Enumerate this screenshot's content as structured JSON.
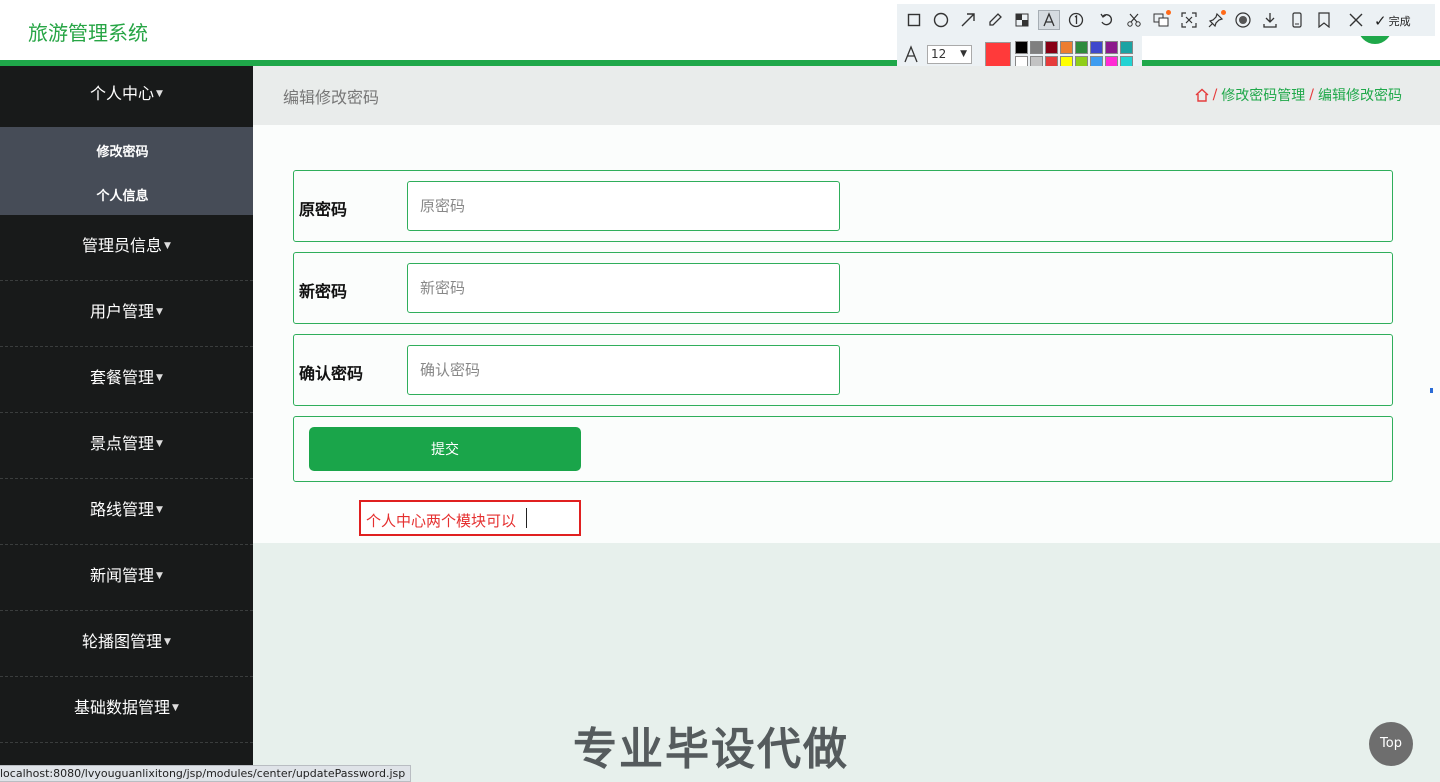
{
  "header": {
    "title": "旅游管理系统"
  },
  "screenshot_tool": {
    "tools": [
      "rectangle-icon",
      "ellipse-icon",
      "arrow-icon",
      "pencil-icon",
      "mosaic-icon",
      "text-icon",
      "number-icon",
      "undo-icon",
      "cut-icon",
      "translate-icon",
      "scan-icon",
      "pin-icon",
      "record-icon",
      "download-icon",
      "phone-icon",
      "bookmark-icon",
      "close-icon"
    ],
    "done_label": "完成",
    "font_size": "12",
    "current_color": "#ff3a3a",
    "palette": [
      "#000000",
      "#7f7f7f",
      "#880015",
      "#ed7d31",
      "#2e8b3c",
      "#3f48cc",
      "#8b1a8b",
      "#1aa3a3",
      "#ffffff",
      "#c3c3c3",
      "#e63c3c",
      "#ffff00",
      "#8fce1a",
      "#3d9cf0",
      "#ff2ad4",
      "#22d3d3"
    ]
  },
  "sidebar": {
    "items": [
      {
        "label": "个人中心"
      },
      {
        "label": "管理员信息"
      },
      {
        "label": "用户管理"
      },
      {
        "label": "套餐管理"
      },
      {
        "label": "景点管理"
      },
      {
        "label": "路线管理"
      },
      {
        "label": "新闻管理"
      },
      {
        "label": "轮播图管理"
      },
      {
        "label": "基础数据管理"
      }
    ],
    "submenu": [
      {
        "label": "修改密码"
      },
      {
        "label": "个人信息"
      }
    ]
  },
  "page": {
    "heading": "编辑修改密码",
    "breadcrumb": [
      "修改密码管理",
      "编辑修改密码"
    ]
  },
  "form": {
    "fields": [
      {
        "label": "原密码",
        "placeholder": "原密码",
        "value": ""
      },
      {
        "label": "新密码",
        "placeholder": "新密码",
        "value": ""
      },
      {
        "label": "确认密码",
        "placeholder": "确认密码",
        "value": ""
      }
    ],
    "submit_label": "提交"
  },
  "annotation": {
    "text": "个人中心两个模块可以"
  },
  "watermark": "专业毕设代做",
  "top_button": "Top",
  "status_url": "localhost:8080/lvyouguanlixitong/jsp/modules/center/updatePassword.jsp"
}
